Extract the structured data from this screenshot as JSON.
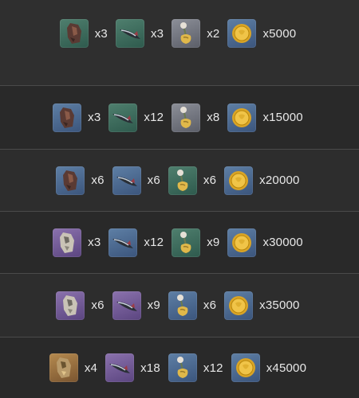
{
  "rows": [
    {
      "items": [
        {
          "icon": "ore-chunk-icon",
          "rarity": "green",
          "qty": "x3"
        },
        {
          "icon": "fish-icon",
          "rarity": "green",
          "qty": "x3"
        },
        {
          "icon": "plant-bud-icon",
          "rarity": "grey",
          "qty": "x2"
        },
        {
          "icon": "gold-coin-icon",
          "rarity": "blue",
          "qty": "x5000"
        }
      ]
    },
    {
      "items": [
        {
          "icon": "ore-chunk-icon",
          "rarity": "blue",
          "qty": "x3"
        },
        {
          "icon": "fish-icon",
          "rarity": "green",
          "qty": "x12"
        },
        {
          "icon": "plant-bud-icon",
          "rarity": "grey",
          "qty": "x8"
        },
        {
          "icon": "gold-coin-icon",
          "rarity": "blue",
          "qty": "x15000"
        }
      ]
    },
    {
      "items": [
        {
          "icon": "ore-chunk-icon",
          "rarity": "blue",
          "qty": "x6"
        },
        {
          "icon": "fish-icon",
          "rarity": "blue",
          "qty": "x6"
        },
        {
          "icon": "plant-bud-icon",
          "rarity": "green",
          "qty": "x6"
        },
        {
          "icon": "gold-coin-icon",
          "rarity": "blue",
          "qty": "x20000"
        }
      ]
    },
    {
      "items": [
        {
          "icon": "crystal-ore-icon",
          "rarity": "purple",
          "qty": "x3"
        },
        {
          "icon": "fish-icon",
          "rarity": "blue",
          "qty": "x12"
        },
        {
          "icon": "plant-bud-icon",
          "rarity": "green",
          "qty": "x9"
        },
        {
          "icon": "gold-coin-icon",
          "rarity": "blue",
          "qty": "x30000"
        }
      ]
    },
    {
      "items": [
        {
          "icon": "crystal-ore-icon",
          "rarity": "purple",
          "qty": "x6"
        },
        {
          "icon": "fish-icon",
          "rarity": "purple",
          "qty": "x9"
        },
        {
          "icon": "plant-bud-icon",
          "rarity": "blue",
          "qty": "x6"
        },
        {
          "icon": "gold-coin-icon",
          "rarity": "blue",
          "qty": "x35000"
        }
      ]
    },
    {
      "items": [
        {
          "icon": "gold-ore-icon",
          "rarity": "gold",
          "qty": "x4"
        },
        {
          "icon": "fish-icon",
          "rarity": "purple",
          "qty": "x18"
        },
        {
          "icon": "plant-bud-icon",
          "rarity": "blue",
          "qty": "x12"
        },
        {
          "icon": "gold-coin-icon",
          "rarity": "blue",
          "qty": "x45000"
        }
      ]
    }
  ]
}
